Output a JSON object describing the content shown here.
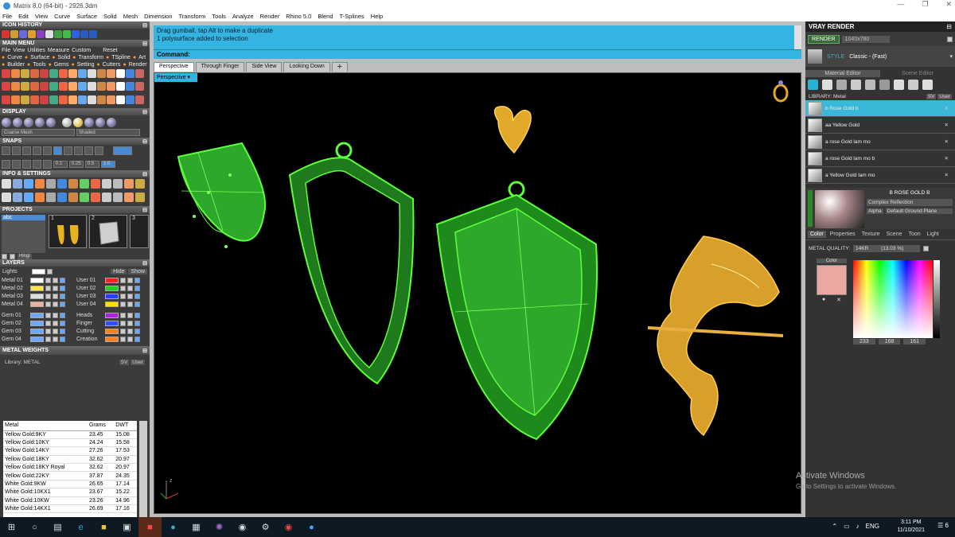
{
  "window": {
    "title": "Matrix 8.0 (64-bit) - 2926.3dm"
  },
  "menu": [
    "File",
    "Edit",
    "View",
    "Curve",
    "Surface",
    "Solid",
    "Mesh",
    "Dimension",
    "Transform",
    "Tools",
    "Analyze",
    "Render",
    "Rhino 5.0",
    "Blend",
    "T-Splines",
    "Help"
  ],
  "left": {
    "icon_history": "ICON HISTORY",
    "main_menu": "MAIN MENU",
    "main_menu_items": [
      "File",
      "View",
      "Utilities",
      "Measure",
      "Custom"
    ],
    "reset": "Reset",
    "row2": [
      "Curve",
      "Surface",
      "Solid",
      "Transform",
      "TSpline",
      "Art"
    ],
    "row3": [
      "Builder",
      "Tools",
      "Gems",
      "Setting",
      "Cutters",
      "Render"
    ],
    "display": "DISPLAY",
    "display_mesh": "Coarse Mesh",
    "display_mode": "Shaded",
    "snaps": "SNAPS",
    "snap_values": [
      "0.1",
      "0.25",
      "0.5",
      "1.0"
    ],
    "info_settings": "INFO & SETTINGS",
    "projects": "PROJECTS",
    "project_name": "abc",
    "project_nums": [
      "1",
      "2",
      "3"
    ],
    "hinge": "Hingi",
    "layers": "LAYERS",
    "lights": "Lights",
    "hide": "Hide",
    "show": "Show",
    "layers_left": [
      {
        "name": "Metal 01",
        "color": "#ffffff"
      },
      {
        "name": "Metal 02",
        "color": "#ffe24a"
      },
      {
        "name": "Metal 03",
        "color": "#dddddd"
      },
      {
        "name": "Metal 04",
        "color": "#f0b0a0"
      },
      {
        "name": "Gem 01",
        "color": "#6fa8ff"
      },
      {
        "name": "Gem 02",
        "color": "#6fa8ff"
      },
      {
        "name": "Gem 03",
        "color": "#6fa8ff"
      },
      {
        "name": "Gem 04",
        "color": "#6fa8ff"
      }
    ],
    "layers_right": [
      {
        "name": "User 01",
        "color": "#ff2020"
      },
      {
        "name": "User 02",
        "color": "#20d020"
      },
      {
        "name": "User 03",
        "color": "#2040ff"
      },
      {
        "name": "User 04",
        "color": "#ffe000"
      },
      {
        "name": "Heads",
        "color": "#b020e0"
      },
      {
        "name": "Finger",
        "color": "#3050ff"
      },
      {
        "name": "Cutting",
        "color": "#ff8020"
      },
      {
        "name": "Creation",
        "color": "#ff8020"
      }
    ],
    "metal_weights": "METAL WEIGHTS",
    "library_label": "Library: METAL",
    "sv_label": "SV",
    "user_label": "User",
    "table_headers": [
      "Metal",
      "Grams",
      "DWT"
    ],
    "table_rows": [
      [
        "Yellow Gold:9KY",
        "23.45",
        "15.08"
      ],
      [
        "Yellow Gold:10KY",
        "24.24",
        "15.58"
      ],
      [
        "Yellow Gold:14KY",
        "27.26",
        "17.53"
      ],
      [
        "Yellow Gold:18KY",
        "32.62",
        "20.97"
      ],
      [
        "Yellow Gold:18KY Royal",
        "32.62",
        "20.97"
      ],
      [
        "Yellow Gold:22KY",
        "37.87",
        "24.35"
      ],
      [
        "White Gold:9KW",
        "26.65",
        "17.14"
      ],
      [
        "White Gold:10KX1",
        "23.67",
        "15.22"
      ],
      [
        "White Gold:10KW",
        "23.26",
        "14.96"
      ],
      [
        "White Gold:14KX1",
        "26.69",
        "17.16"
      ]
    ]
  },
  "center": {
    "history_line1": "Drag gumball, tap Alt to make a duplicate",
    "history_line2": "1 polysurface added to selection",
    "command_label": "Command:",
    "tabs": [
      "Perspective",
      "Through Finger",
      "Side View",
      "Looking Down"
    ],
    "viewport_label": "Perspective",
    "axis_z": "z",
    "axis_x": "x"
  },
  "right": {
    "title": "VRAY RENDER",
    "render_btn": "RENDER",
    "resolution": "1040x780",
    "style_label": "STYLE",
    "style_value": "Classic - (Fast)",
    "tab_material": "Material Editor",
    "tab_scene": "Scene Editor",
    "library": "LIBRARY: Metal",
    "sv": "SV",
    "user": "User",
    "materials": [
      "b Rose Gold b",
      "aa Yellow Gold",
      "a rose Gold lam mo",
      "a rose Gold lam mo b",
      "a Yellow Gold lam mo"
    ],
    "selected_material": "B ROSE GOLD B",
    "complex": "Complex Reflection",
    "alpha": "Alpha",
    "ground": "Default Ground Plane",
    "subtabs": [
      "Color",
      "Properties",
      "Texture",
      "Scene",
      "Toon",
      "Light"
    ],
    "metal_quality_label": "METAL QUALITY:",
    "metal_quality": "14KR",
    "metal_quality_val": "(13.03 %)",
    "color_label": "Color",
    "rgb": [
      "233",
      "168",
      "161"
    ],
    "swatch": "#e9a8a1"
  },
  "watermark": {
    "line1": "Activate Windows",
    "line2": "Go to Settings to activate Windows."
  },
  "taskbar": {
    "lang": "ENG",
    "time": "3:11 PM",
    "date": "11/10/2021",
    "notif": "6"
  }
}
